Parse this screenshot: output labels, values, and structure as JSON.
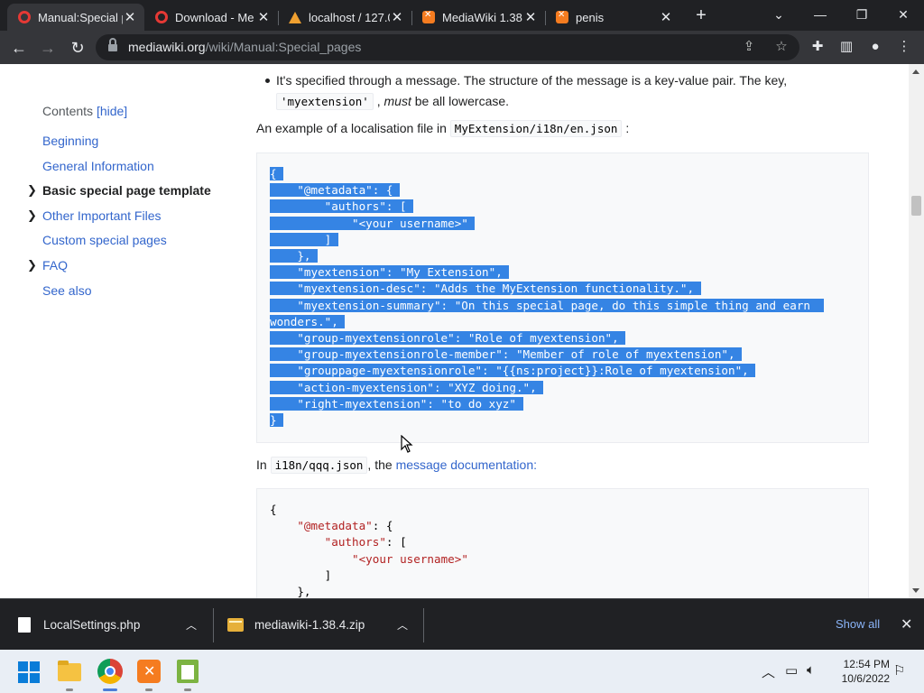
{
  "tabs": [
    {
      "title": "Manual:Special p",
      "favicon": "opera-icon",
      "active": true
    },
    {
      "title": "Download - Me",
      "favicon": "opera-icon",
      "active": false
    },
    {
      "title": "localhost / 127.0",
      "favicon": "phpmyadmin-icon",
      "active": false
    },
    {
      "title": "MediaWiki 1.38.",
      "favicon": "xampp-icon",
      "active": false
    },
    {
      "title": "penis",
      "favicon": "xampp-icon",
      "active": false
    }
  ],
  "omnibox": {
    "domain": "mediawiki.org",
    "path": "/wiki/Manual:Special_pages"
  },
  "toc": {
    "heading": "Contents",
    "hide_label": "[hide]",
    "items": [
      {
        "label": "Beginning",
        "expandable": false
      },
      {
        "label": "General Information",
        "expandable": false
      },
      {
        "label": "Basic special page template",
        "expandable": true,
        "active": true
      },
      {
        "label": "Other Important Files",
        "expandable": true
      },
      {
        "label": "Custom special pages",
        "expandable": false
      },
      {
        "label": "FAQ",
        "expandable": true
      },
      {
        "label": "See also",
        "expandable": false
      }
    ]
  },
  "content": {
    "bullet_line1": "It's specified through a message. The structure of the message is a key-value pair. The key,",
    "bullet_code": "'myextension'",
    "bullet_must": "must",
    "bullet_tail": "be all lowercase.",
    "example_text": "An example of a localisation file in",
    "example_path": "MyExtension/i18n/en.json",
    "example_colon": ":",
    "en_json_lines": [
      "{",
      "    \"@metadata\": {",
      "        \"authors\": [",
      "            \"<your username>\"",
      "        ]",
      "    },",
      "    \"myextension\": \"My Extension\",",
      "    \"myextension-desc\": \"Adds the MyExtension functionality.\",",
      "    \"myextension-summary\": \"On this special page, do this simple thing and earn ",
      "wonders.\",",
      "    \"group-myextensionrole\": \"Role of myextension\",",
      "    \"group-myextensionrole-member\": \"Member of role of myextension\",",
      "    \"grouppage-myextensionrole\": \"{{ns:project}}:Role of myextension\",",
      "    \"action-myextension\": \"XYZ doing.\",",
      "    \"right-myextension\": \"to do xyz\"",
      "}"
    ],
    "in_text": "In",
    "qqq_path": "i18n/qqq.json",
    "in_mid": ", the",
    "qqq_link": "message documentation:",
    "qqq_lines_partial": [
      "{",
      "    \"@metadata\": {",
      "        \"authors\": [",
      "            \"<your username>\"",
      "        ]",
      "    },"
    ]
  },
  "downloads": [
    {
      "name": "LocalSettings.php",
      "icon": "php-file-icon"
    },
    {
      "name": "mediawiki-1.38.4.zip",
      "icon": "zip-file-icon"
    }
  ],
  "download_bar": {
    "show_all": "Show all"
  },
  "clock": {
    "time": "12:54 PM",
    "date": "10/6/2022"
  }
}
